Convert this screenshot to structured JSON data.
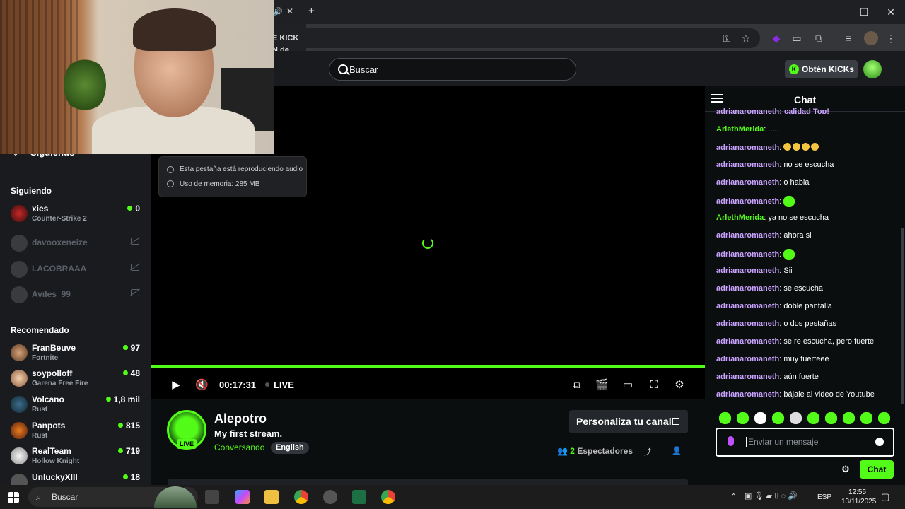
{
  "browser": {
    "tab_partial_1": "E KICK",
    "tab_partial_2": "N de ...",
    "close_tab": "✕",
    "new_tab": "+",
    "win_min": "—",
    "win_max": "☐",
    "win_close": "✕"
  },
  "tooltip": {
    "line1": "Esta pestaña está reproduciendo audio",
    "line2": "Uso de memoria: 285 MB"
  },
  "header": {
    "search_placeholder": "Buscar",
    "get_kicks": "Obtén KICKs"
  },
  "sidebar": {
    "section_partial": "Siguiendo",
    "following_title": "Siguiendo",
    "following": [
      {
        "name": "xies",
        "game": "Counter-Strike 2",
        "viewers": "0",
        "online": true
      },
      {
        "name": "davooxeneize",
        "online": false
      },
      {
        "name": "LACOBRAAA",
        "online": false
      },
      {
        "name": "Aviles_99",
        "online": false
      }
    ],
    "recommended_title": "Recomendado",
    "recommended": [
      {
        "name": "FranBeuve",
        "game": "Fortnite",
        "viewers": "97"
      },
      {
        "name": "soypolloff",
        "game": "Garena Free Fire",
        "viewers": "48"
      },
      {
        "name": "Volcano",
        "game": "Rust",
        "viewers": "1,8 mil"
      },
      {
        "name": "Panpots",
        "game": "Rust",
        "viewers": "815"
      },
      {
        "name": "RealTeam",
        "game": "Hollow Knight",
        "viewers": "719"
      },
      {
        "name": "UnluckyXIII",
        "game": "",
        "viewers": "18"
      }
    ]
  },
  "player": {
    "time": "00:17:31",
    "live": "LIVE",
    "progress": 1.0
  },
  "channel": {
    "name": "Alepotro",
    "live_badge": "LIVE",
    "title": "My first stream.",
    "category": "Conversando",
    "language": "English",
    "customize_label": "Personaliza tu canal",
    "viewers_count": "2",
    "viewers_label": "Espectadores"
  },
  "chat": {
    "title": "Chat",
    "top_partial": "adrianaromaneth: calidad Top!",
    "messages": [
      {
        "user": "ArlethMerida",
        "text": ".....",
        "color": "#53fc18"
      },
      {
        "user": "adrianaromaneth",
        "text": "",
        "emoji_count": 4,
        "color": "#c9a2ff"
      },
      {
        "user": "adrianaromaneth",
        "text": "no se escucha",
        "color": "#c9a2ff"
      },
      {
        "user": "adrianaromaneth",
        "text": "o habla",
        "color": "#c9a2ff"
      },
      {
        "user": "adrianaromaneth",
        "text": "",
        "emote": true,
        "color": "#c9a2ff"
      },
      {
        "user": "ArlethMerida",
        "text": "ya no se escucha",
        "color": "#53fc18"
      },
      {
        "user": "adrianaromaneth",
        "text": "ahora si",
        "color": "#c9a2ff"
      },
      {
        "user": "adrianaromaneth",
        "text": "",
        "emote": true,
        "color": "#c9a2ff"
      },
      {
        "user": "adrianaromaneth",
        "text": "Sii",
        "color": "#c9a2ff"
      },
      {
        "user": "adrianaromaneth",
        "text": "se escucha",
        "color": "#c9a2ff"
      },
      {
        "user": "adrianaromaneth",
        "text": "doble pantalla",
        "color": "#c9a2ff"
      },
      {
        "user": "adrianaromaneth",
        "text": "o dos pestañas",
        "color": "#c9a2ff"
      },
      {
        "user": "adrianaromaneth",
        "text": "se re escucha, pero fuerte",
        "color": "#c9a2ff"
      },
      {
        "user": "adrianaromaneth",
        "text": "muy fuerteee",
        "color": "#c9a2ff"
      },
      {
        "user": "adrianaromaneth",
        "text": "aún fuerte",
        "color": "#c9a2ff"
      },
      {
        "user": "adrianaromaneth",
        "text": "bájale al video de Youtube",
        "color": "#c9a2ff"
      }
    ],
    "input_placeholder": "Enviar un mensaje",
    "send_label": "Chat"
  },
  "taskbar": {
    "search": "Buscar",
    "lang": "ESP",
    "time": "12:55",
    "date": "13/11/2025"
  },
  "colors": {
    "accent": "#53fc18",
    "username_purple": "#c9a2ff"
  }
}
